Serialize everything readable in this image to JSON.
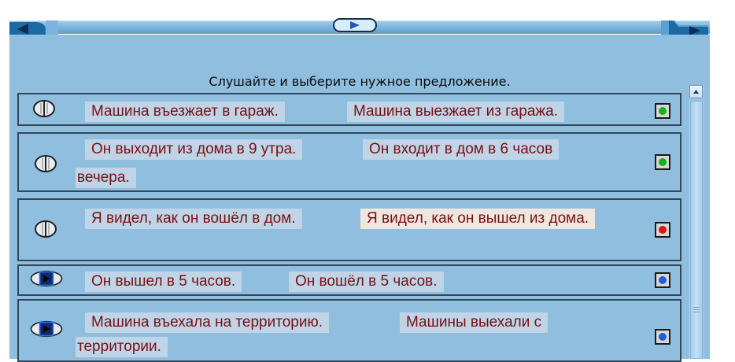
{
  "instruction": "Слушайте и выберите нужное предложение.",
  "rows": [
    {
      "option_a": "Машина въезжает в гараж.",
      "option_b": "Машина выезжает из гаража.",
      "option_b_cont": "",
      "status": "green",
      "speaker": "speaker-idle"
    },
    {
      "option_a": "Он выходит из дома в 9 утра.",
      "option_b": "Он входит в дом в 6 часов",
      "option_b_cont": "вечера.",
      "status": "green",
      "speaker": "speaker-idle"
    },
    {
      "option_a": "Я видел, как он вошёл в дом.",
      "option_b": "Я видел, как он вышел из дома.",
      "option_b_cont": "",
      "status": "red",
      "speaker": "speaker-idle"
    },
    {
      "option_a": "Он вышел в 5 часов.",
      "option_b": "Он вошёл в 5 часов.",
      "option_b_cont": "",
      "status": "blue",
      "speaker": "speaker-active"
    },
    {
      "option_a": "Машина въехала на территорию.",
      "option_b": "Машины выехали с",
      "option_b_cont": "территории.",
      "status": "blue",
      "speaker": "speaker-active"
    }
  ],
  "colors": {
    "green": "#12b419",
    "red": "#e01414",
    "blue": "#1f5fd6"
  }
}
